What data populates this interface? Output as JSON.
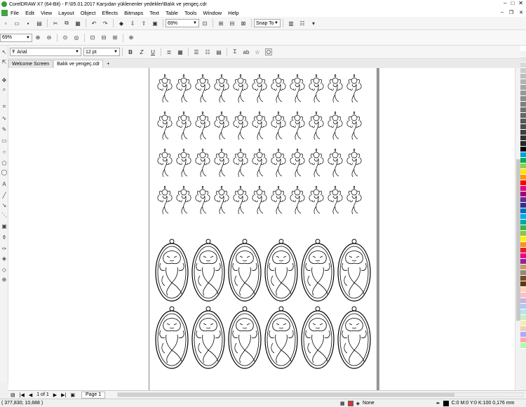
{
  "window": {
    "title": "CorelDRAW X7 (64-Bit) - F:\\05.01.2017 Karşıdan yüklenenler yedekler\\Balık ve yengeç.cdr",
    "min": "–",
    "max": "□",
    "close": "✕"
  },
  "menu": [
    "File",
    "Edit",
    "View",
    "Layout",
    "Object",
    "Effects",
    "Bitmaps",
    "Text",
    "Table",
    "Tools",
    "Window",
    "Help"
  ],
  "toolbar1": {
    "zoom_value": "69%",
    "snap_label": "Snap To"
  },
  "toolbar2": {
    "zoom_value": "69%"
  },
  "toolbar3": {
    "font_name": "Arial",
    "font_size": "12 pt"
  },
  "tabs": [
    {
      "label": "Welcome Screen",
      "active": false
    },
    {
      "label": "Balık ve yengeç.cdr",
      "active": true
    }
  ],
  "navigation": {
    "page_count": "1 of 1",
    "page_tab": "Page 1"
  },
  "status": {
    "coords": "( 377,830; 10,688 )",
    "fill": "None",
    "outline": "C:0 M:0 Y:0 K:100  0,176 mm"
  },
  "palette": [
    "#ffffff",
    "#f2f2f2",
    "#e6e6e6",
    "#d9d9d9",
    "#cccccc",
    "#bfbfbf",
    "#b3b3b3",
    "#a6a6a6",
    "#999999",
    "#8c8c8c",
    "#808080",
    "#737373",
    "#666666",
    "#595959",
    "#4d4d4d",
    "#404040",
    "#333333",
    "#262626",
    "#000000",
    "#00a0e0",
    "#00b050",
    "#8fd14f",
    "#ffe600",
    "#ff9900",
    "#ff0000",
    "#e6007e",
    "#a0007e",
    "#662d91",
    "#2e3192",
    "#0072bc",
    "#00aeef",
    "#00a99d",
    "#39b54a",
    "#8dc63f",
    "#fff200",
    "#f7941d",
    "#ed1c24",
    "#ec008c",
    "#92278f",
    "#c69c6d",
    "#998675",
    "#754c24",
    "#603913",
    "#ffd5b3",
    "#ffc0cb",
    "#c8b4e6",
    "#b4c8f0",
    "#b4e6f0",
    "#c8f0c8",
    "#f0f0b4",
    "#f0d2b4",
    "#aaaaff",
    "#ffaaaa",
    "#aaffaa"
  ]
}
